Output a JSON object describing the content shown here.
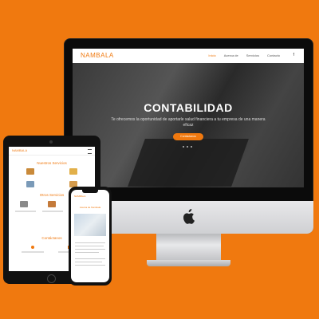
{
  "colors": {
    "background": "#f0790f",
    "accent": "#f0790f"
  },
  "desktop": {
    "logo": "NAMBALA",
    "menu": [
      "Inicio",
      "Acerca de",
      "Servicios",
      "Contacto"
    ],
    "facebook_icon": "f",
    "hero": {
      "title": "CONTABILIDAD",
      "subtitle": "Te ofrecemos la oportunidad de aportarle salud financiera a tu empresa de una manera eficaz",
      "button": "Contáctanos"
    }
  },
  "tablet": {
    "logo": "NAMBALA",
    "section1": "Nuestros Servicios",
    "section2": "Otros Servicios",
    "section3": "Contáctanos"
  },
  "phone": {
    "logo": "NAMBALA",
    "heading": "Acerca de Nambala"
  }
}
